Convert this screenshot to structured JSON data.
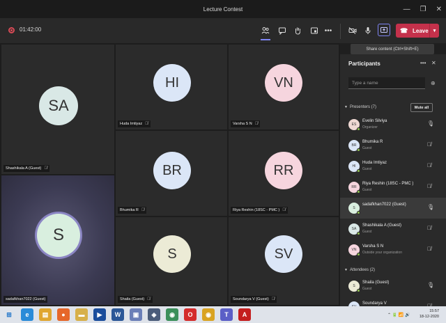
{
  "window": {
    "title": "Lecture Contest",
    "minimize": "—",
    "maximize": "❐",
    "close": "✕"
  },
  "toolbar": {
    "timer": "01:42:00",
    "icons": [
      "participants-icon",
      "chat-icon",
      "raise-hand-icon",
      "rooms-icon",
      "more-icon",
      "camera-icon",
      "mic-icon",
      "share-icon"
    ],
    "more": "•••",
    "leave_label": "Leave",
    "share_tooltip": "Share content (Ctrl+Shift+E)"
  },
  "tiles": [
    {
      "initials": "SA",
      "name": "Shashikala A (Guest)",
      "color": "#d9e8e6"
    },
    {
      "initials": "HI",
      "name": "Huda Imtiyaz",
      "color": "#dbe6f7"
    },
    {
      "initials": "VN",
      "name": "Varsha S N",
      "color": "#f6d5de"
    },
    {
      "initials": "BR",
      "name": "Bhumika R",
      "color": "#dbe6f7"
    },
    {
      "initials": "RR",
      "name": "Riya Reshin (18SC - PMC )",
      "color": "#f6d5de"
    },
    {
      "initials": "S",
      "name": "sadafkhan7022 (Guest)",
      "color": "#d9efdf"
    },
    {
      "initials": "S",
      "name": "Shaila (Guest)",
      "color": "#ecebd6"
    },
    {
      "initials": "SV",
      "name": "Soundarya V (Guest)",
      "color": "#dbe6f7"
    }
  ],
  "panel": {
    "title": "Participants",
    "more": "•••",
    "close": "✕",
    "search_placeholder": "Type a name",
    "presenters_header": "Presenters (7)",
    "mute_all": "Mute all",
    "presenters": [
      {
        "initials": "ES",
        "name": "Evelin Silviya",
        "role": "Organizer",
        "color": "#f0d9d3"
      },
      {
        "initials": "BR",
        "name": "Bhumika R",
        "role": "Guest",
        "color": "#dbe6f7"
      },
      {
        "initials": "HI",
        "name": "Huda Imtiyaz",
        "role": "Guest",
        "color": "#dbe6f7"
      },
      {
        "initials": "RR",
        "name": "Riya Reshin (18SC - PMC )",
        "role": "Guest",
        "color": "#f6d5de"
      },
      {
        "initials": "S",
        "name": "sadafkhan7022 (Guest)",
        "role": "",
        "color": "#d9efdf"
      },
      {
        "initials": "SA",
        "name": "Shashikala A (Guest)",
        "role": "Guest",
        "color": "#d9e8e6"
      },
      {
        "initials": "VN",
        "name": "Varsha S N",
        "role": "Outside your organization",
        "color": "#f6d5de"
      }
    ],
    "attendees_header": "Attendees (2)",
    "attendees": [
      {
        "initials": "S",
        "name": "Shaila (Guest)",
        "role": "Guest",
        "color": "#ecebd6"
      },
      {
        "initials": "SV",
        "name": "Soundarya V",
        "role": "",
        "color": "#dbe6f7"
      }
    ]
  },
  "taskbar": {
    "apps": [
      {
        "name": "start-icon",
        "glyph": "⊞",
        "color": "#1e73c8"
      },
      {
        "name": "ie-icon",
        "glyph": "e",
        "color": "#2a8bd8"
      },
      {
        "name": "file-explorer-icon",
        "glyph": "▤",
        "color": "#e0a630"
      },
      {
        "name": "firefox-icon",
        "glyph": "●",
        "color": "#e6672a"
      },
      {
        "name": "folder-icon",
        "glyph": "▬",
        "color": "#d7b04a"
      },
      {
        "name": "media-icon",
        "glyph": "▶",
        "color": "#1a4d9c"
      },
      {
        "name": "word-icon",
        "glyph": "W",
        "color": "#2b5797"
      },
      {
        "name": "photos-icon",
        "glyph": "▣",
        "color": "#6b7fb8"
      },
      {
        "name": "network-icon",
        "glyph": "◈",
        "color": "#4b5c7a"
      },
      {
        "name": "chrome-alt-icon",
        "glyph": "◉",
        "color": "#3b8f5a"
      },
      {
        "name": "opera-icon",
        "glyph": "O",
        "color": "#d42c2c"
      },
      {
        "name": "chrome-icon",
        "glyph": "◉",
        "color": "#d9a322"
      },
      {
        "name": "teams-icon",
        "glyph": "T",
        "color": "#5b5fc7"
      },
      {
        "name": "pdf-icon",
        "glyph": "A",
        "color": "#c41e1e"
      }
    ],
    "time": "15:57",
    "date": "18-12-2020"
  }
}
